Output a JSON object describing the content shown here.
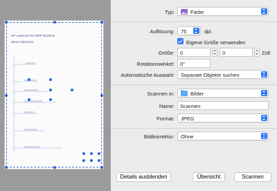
{
  "preview": {
    "document_lines": [
      "HP LaserJet Pro MFP M125nw",
      "Menu Structure"
    ]
  },
  "settings": {
    "type": {
      "label": "Typ:",
      "value": "Farbe",
      "icon": "photo-icon"
    },
    "resolution": {
      "label": "Auflösung:",
      "value": "75",
      "unit": "dpi"
    },
    "custom_size": {
      "label": "Eigene Größe verwenden",
      "checked": true
    },
    "size": {
      "label": "Größe:",
      "width": "0",
      "height": "0",
      "unit": "Zoll"
    },
    "rotation": {
      "label": "Rotationswinkel:",
      "value": "0°"
    },
    "auto_select": {
      "label": "Automatische Auswahl:",
      "value": "Separate Objekte suchen"
    },
    "scan_to": {
      "label": "Scannen in:",
      "value": "Bilder",
      "icon": "folder-icon"
    },
    "name": {
      "label": "Name:",
      "value": "Scannen"
    },
    "format": {
      "label": "Format:",
      "value": "JPEG"
    },
    "correction": {
      "label": "Bildkorrektur:",
      "value": "Ohne"
    }
  },
  "buttons": {
    "hide_details": "Details ausblenden",
    "overview": "Übersicht",
    "scan": "Scannen"
  },
  "colors": {
    "accent": "#2f7bf5",
    "selection": "#4a6fd8"
  }
}
